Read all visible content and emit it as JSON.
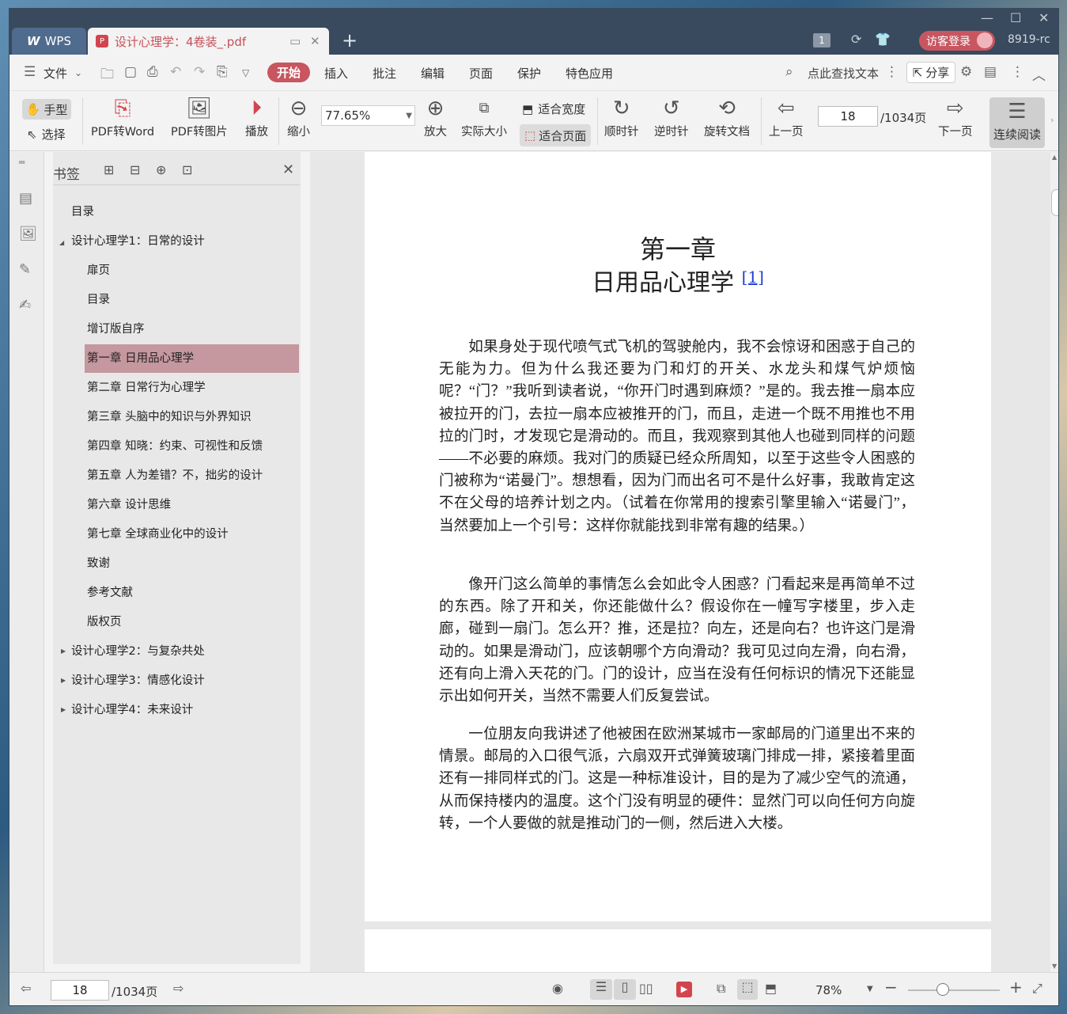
{
  "titlebar": {
    "wps_label": "WPS",
    "doc_tab_title": "设计心理学：4卷装_.pdf",
    "badge": "1",
    "login_label": "访客登录",
    "user_id": "8919-rc"
  },
  "menu": {
    "file": "文件",
    "items": [
      "开始",
      "插入",
      "批注",
      "编辑",
      "页面",
      "保护",
      "特色应用"
    ],
    "search_placeholder": "点此查找文本",
    "share": "分享"
  },
  "toolbar": {
    "hand": "手型",
    "select": "选择",
    "pdf_to_word": "PDF转Word",
    "pdf_to_image": "PDF转图片",
    "play": "播放",
    "zoom_out": "缩小",
    "zoom_value": "77.65%",
    "zoom_in": "放大",
    "actual_size": "实际大小",
    "fit_width": "适合宽度",
    "fit_page": "适合页面",
    "rotate_cw": "顺时针",
    "rotate_ccw": "逆时针",
    "rotate_doc": "旋转文档",
    "prev_page": "上一页",
    "page_current": "18",
    "page_total": "/1034页",
    "next_page": "下一页",
    "continuous": "连续阅读"
  },
  "bookmarks": {
    "title": "书签",
    "items": [
      {
        "label": "目录"
      },
      {
        "label": "设计心理学1：日常的设计"
      },
      {
        "label": "扉页"
      },
      {
        "label": "目录"
      },
      {
        "label": "增订版自序"
      },
      {
        "label": "第一章 日用品心理学"
      },
      {
        "label": "第二章 日常行为心理学"
      },
      {
        "label": "第三章 头脑中的知识与外界知识"
      },
      {
        "label": "第四章 知晓：约束、可视性和反馈"
      },
      {
        "label": "第五章 人为差错？不，拙劣的设计"
      },
      {
        "label": "第六章 设计思维"
      },
      {
        "label": "第七章 全球商业化中的设计"
      },
      {
        "label": "致谢"
      },
      {
        "label": "参考文献"
      },
      {
        "label": "版权页"
      },
      {
        "label": "设计心理学2：与复杂共处"
      },
      {
        "label": "设计心理学3：情感化设计"
      },
      {
        "label": "设计心理学4：未来设计"
      }
    ]
  },
  "page": {
    "chapter_number": "第一章",
    "chapter_title": "日用品心理学",
    "footnote_ref": "[1]",
    "paragraphs": [
      "如果身处于现代喷气式飞机的驾驶舱内，我不会惊讶和困惑于自己的无能为力。但为什么我还要为门和灯的开关、水龙头和煤气炉烦恼呢？“门？”我听到读者说，“你开门时遇到麻烦？”是的。我去推一扇本应被拉开的门，去拉一扇本应被推开的门，而且，走进一个既不用推也不用拉的门时，才发现它是滑动的。而且，我观察到其他人也碰到同样的问题——不必要的麻烦。我对门的质疑已经众所周知，以至于这些令人困惑的门被称为“诺曼门”。想想看，因为门而出名可不是什么好事，我敢肯定这不在父母的培养计划之内。（试着在你常用的搜索引擎里输入“诺曼门”，当然要加上一个引号：这样你就能找到非常有趣的结果。）",
      "像开门这么简单的事情怎么会如此令人困惑？门看起来是再简单不过的东西。除了开和关，你还能做什么？假设你在一幢写字楼里，步入走廊，碰到一扇门。怎么开？推，还是拉？向左，还是向右？也许这门是滑动的。如果是滑动门，应该朝哪个方向滑动？我可见过向左滑，向右滑，还有向上滑入天花的门。门的设计，应当在没有任何标识的情况下还能显示出如何开关，当然不需要人们反复尝试。",
      "一位朋友向我讲述了他被困在欧洲某城市一家邮局的门道里出不来的情景。邮局的入口很气派，六扇双开式弹簧玻璃门排成一排，紧接着里面还有一排同样式的门。这是一种标准设计，目的是为了减少空气的流通，从而保持楼内的温度。这个门没有明显的硬件：显然门可以向任何方向旋转，一个人要做的就是推动门的一侧，然后进入大楼。"
    ]
  },
  "statusbar": {
    "page_current": "18",
    "page_total": "/1034页",
    "zoom": "78%"
  },
  "colors": {
    "accent": "#c85660",
    "titlebar": "#394a5e",
    "selected_bookmark": "#c5979e"
  }
}
